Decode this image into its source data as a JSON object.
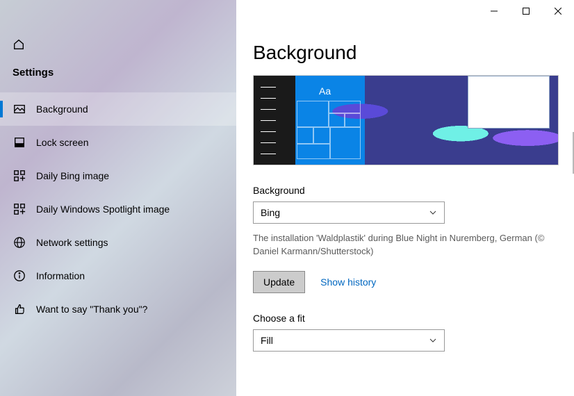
{
  "titlebar": {},
  "sidebar": {
    "heading": "Settings",
    "items": [
      {
        "label": "Background",
        "selected": true
      },
      {
        "label": "Lock screen"
      },
      {
        "label": "Daily Bing image"
      },
      {
        "label": "Daily Windows Spotlight image"
      },
      {
        "label": "Network settings"
      },
      {
        "label": "Information"
      },
      {
        "label": "Want to say \"Thank you\"?"
      }
    ]
  },
  "main": {
    "title": "Background",
    "preview_sample_text": "Aa",
    "background_label": "Background",
    "background_value": "Bing",
    "caption": "The installation 'Waldplastik' during Blue Night in Nuremberg, German (© Daniel Karmann/Shutterstock)",
    "update_label": "Update",
    "show_history_label": "Show history",
    "fit_label": "Choose a fit",
    "fit_value": "Fill"
  }
}
